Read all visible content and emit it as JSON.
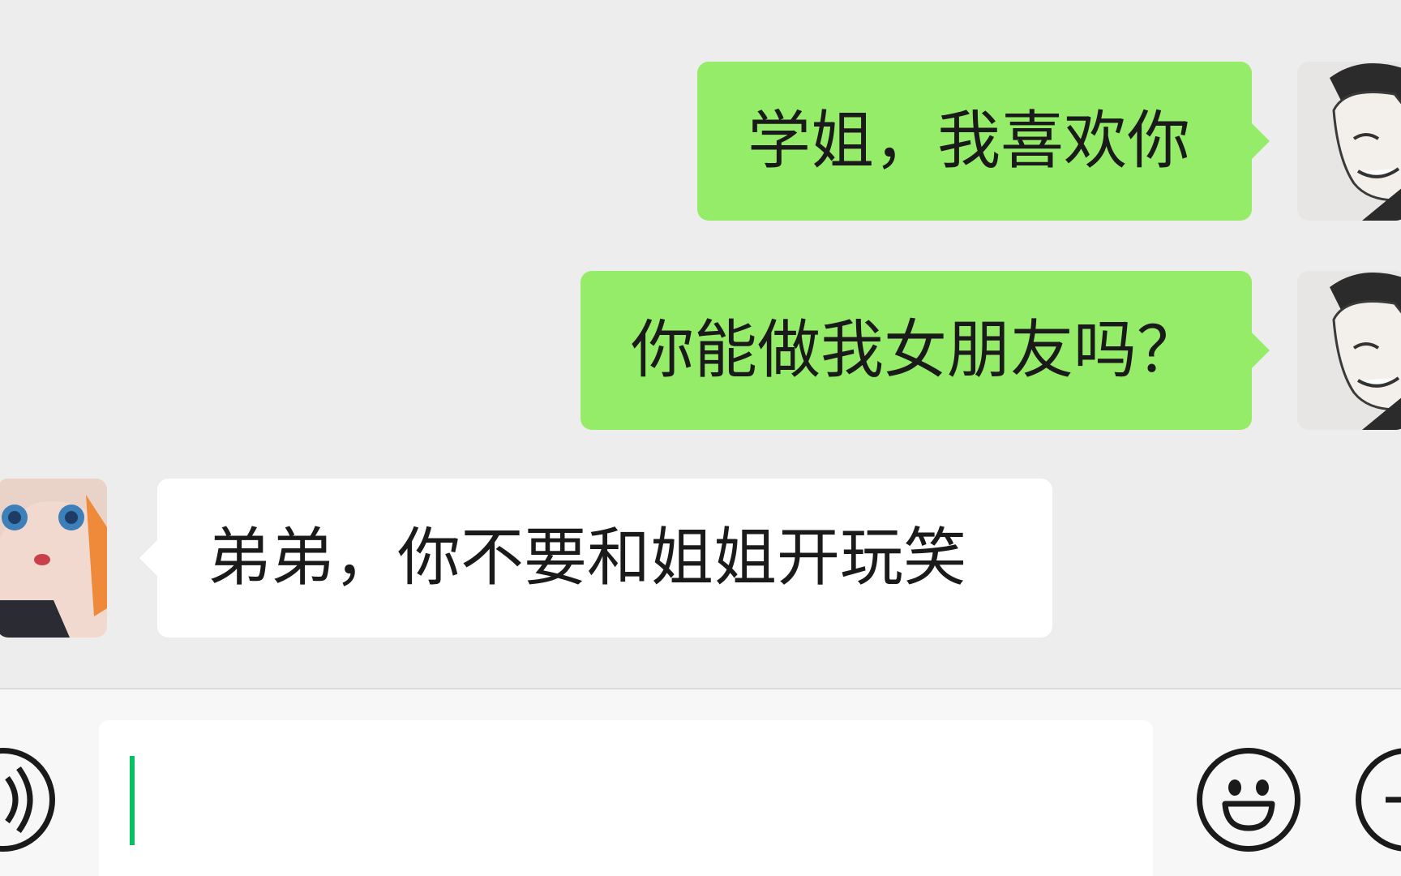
{
  "messages": [
    {
      "side": "out",
      "text": "学姐，我喜欢你"
    },
    {
      "side": "out",
      "text": "你能做我女朋友吗？"
    },
    {
      "side": "in",
      "text": "弟弟，你不要和姐姐开玩笑"
    }
  ],
  "input": {
    "value": ""
  },
  "icons": {
    "voice": "voice-icon",
    "emoji": "emoji-icon",
    "more": "plus-icon"
  },
  "colors": {
    "outgoing_bubble": "#95ec69",
    "incoming_bubble": "#ffffff",
    "background": "#ededed",
    "caret": "#07c160"
  }
}
